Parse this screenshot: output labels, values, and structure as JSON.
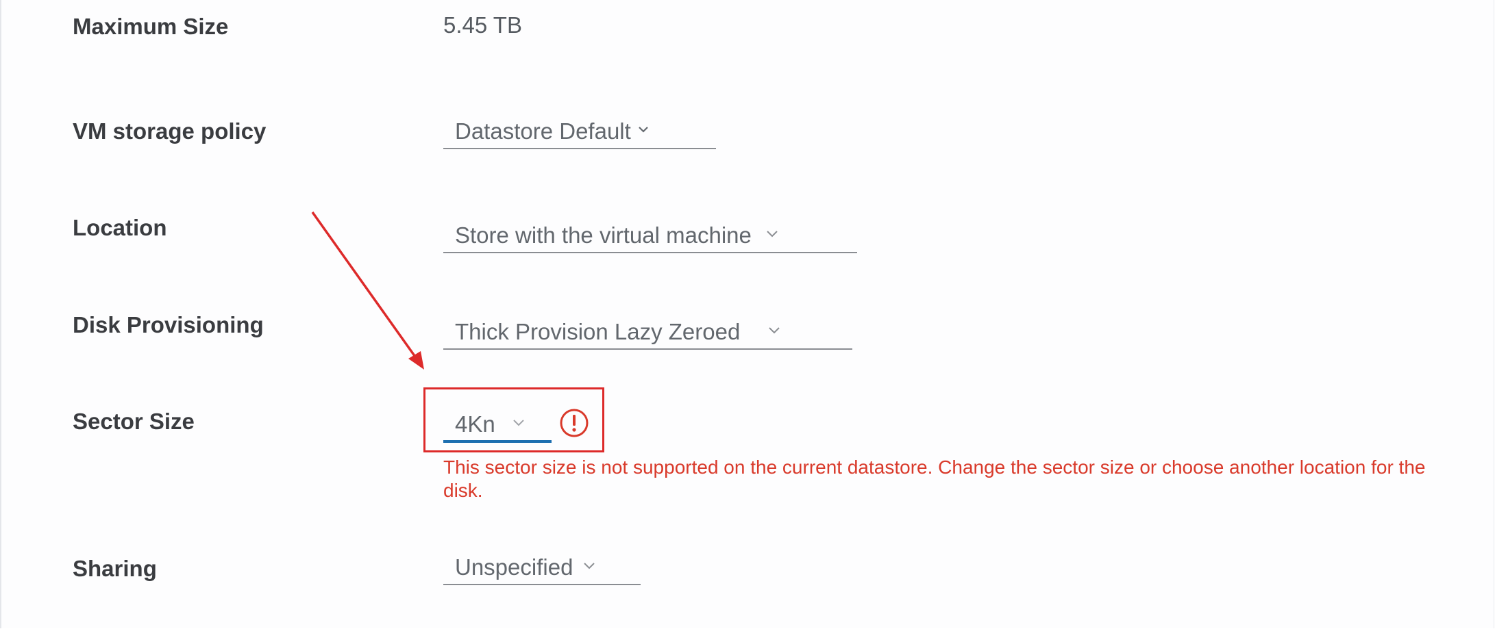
{
  "fields": {
    "max_size": {
      "label": "Maximum Size",
      "value": "5.45 TB"
    },
    "storage_policy": {
      "label": "VM storage policy",
      "value": "Datastore Default"
    },
    "location": {
      "label": "Location",
      "value": "Store with the virtual machine"
    },
    "provisioning": {
      "label": "Disk Provisioning",
      "value": "Thick Provision Lazy Zeroed"
    },
    "sector_size": {
      "label": "Sector Size",
      "value": "4Kn",
      "error": "This sector size is not supported on the current datastore. Change the sector size or choose another location for the disk."
    },
    "sharing": {
      "label": "Sharing",
      "value": "Unspecified"
    }
  },
  "colors": {
    "annotation": "#dd2a2a",
    "error": "#d93a2b",
    "focus_underline": "#1d6fb0"
  },
  "icons": {
    "chevron": "chevron-down-icon",
    "error": "exclamation-circle-icon",
    "annotation": "red-arrow"
  }
}
